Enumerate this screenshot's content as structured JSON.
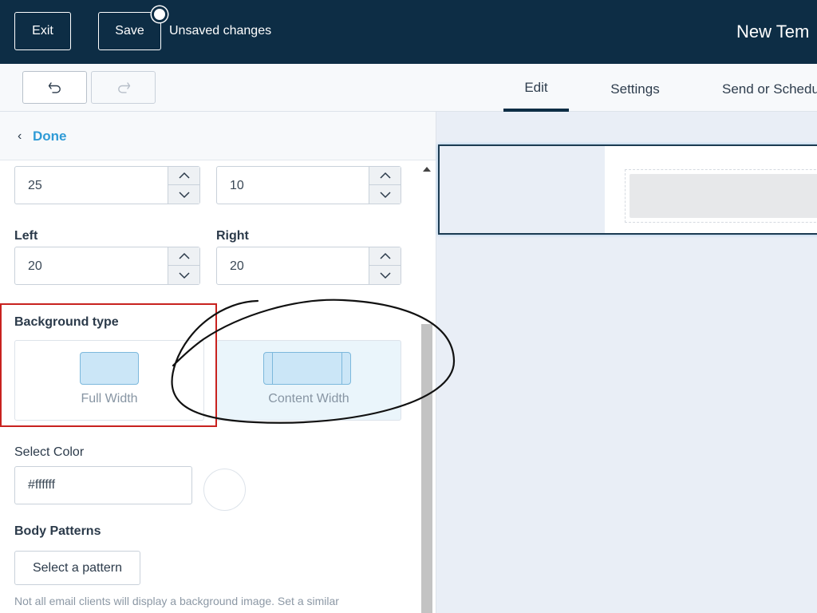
{
  "header": {
    "exit_label": "Exit",
    "save_label": "Save",
    "unsaved_label": "Unsaved changes",
    "title": "New Tem"
  },
  "toolbar": {
    "undo_icon": "undo-icon",
    "redo_icon": "redo-icon",
    "tabs": [
      {
        "label": "Edit",
        "active": true
      },
      {
        "label": "Settings",
        "active": false
      },
      {
        "label": "Send or Schedu",
        "active": false
      }
    ]
  },
  "panel": {
    "done_label": "Done",
    "padding_top": {
      "left_value": "25",
      "right_value": "10"
    },
    "left_label": "Left",
    "right_label": "Right",
    "padding_sides": {
      "left_value": "20",
      "right_value": "20"
    },
    "background_type_label": "Background type",
    "background_options": [
      {
        "label": "Full Width",
        "selected": false
      },
      {
        "label": "Content Width",
        "selected": true
      }
    ],
    "select_color_label": "Select Color",
    "color_value": "#ffffff",
    "body_patterns_label": "Body Patterns",
    "select_pattern_label": "Select a pattern",
    "note": "Not all email clients will display a background image. Set a similar"
  },
  "colors": {
    "header_bg": "#0d2d45",
    "link": "#2f9bd6",
    "annotation_red": "#c8221f"
  }
}
